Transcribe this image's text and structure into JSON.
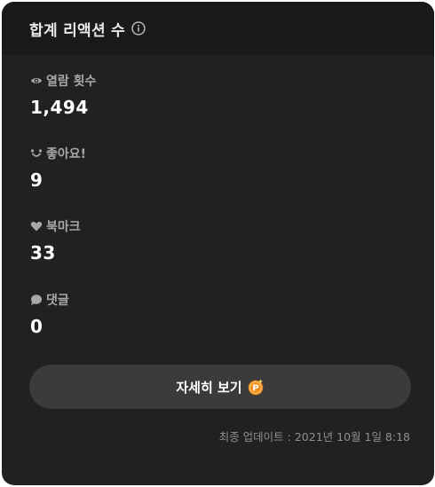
{
  "header": {
    "title": "합계 리액션 수"
  },
  "metrics": [
    {
      "icon": "eye-icon",
      "label": "열람 횟수",
      "value": "1,494"
    },
    {
      "icon": "smile-icon",
      "label": "좋아요!",
      "value": "9"
    },
    {
      "icon": "heart-icon",
      "label": "북마크",
      "value": "33"
    },
    {
      "icon": "comment-icon",
      "label": "댓글",
      "value": "0"
    }
  ],
  "detail_button": {
    "label": "자세히 보기",
    "icon": "point-coin-icon",
    "coin_letter": "P"
  },
  "last_updated": "최종 업데이트 : 2021년 10월 1일 8:18",
  "colors": {
    "card_bg": "#212121",
    "header_bg": "#1a1a1a",
    "button_bg": "#3b3b3b",
    "coin": "#f4901e"
  }
}
